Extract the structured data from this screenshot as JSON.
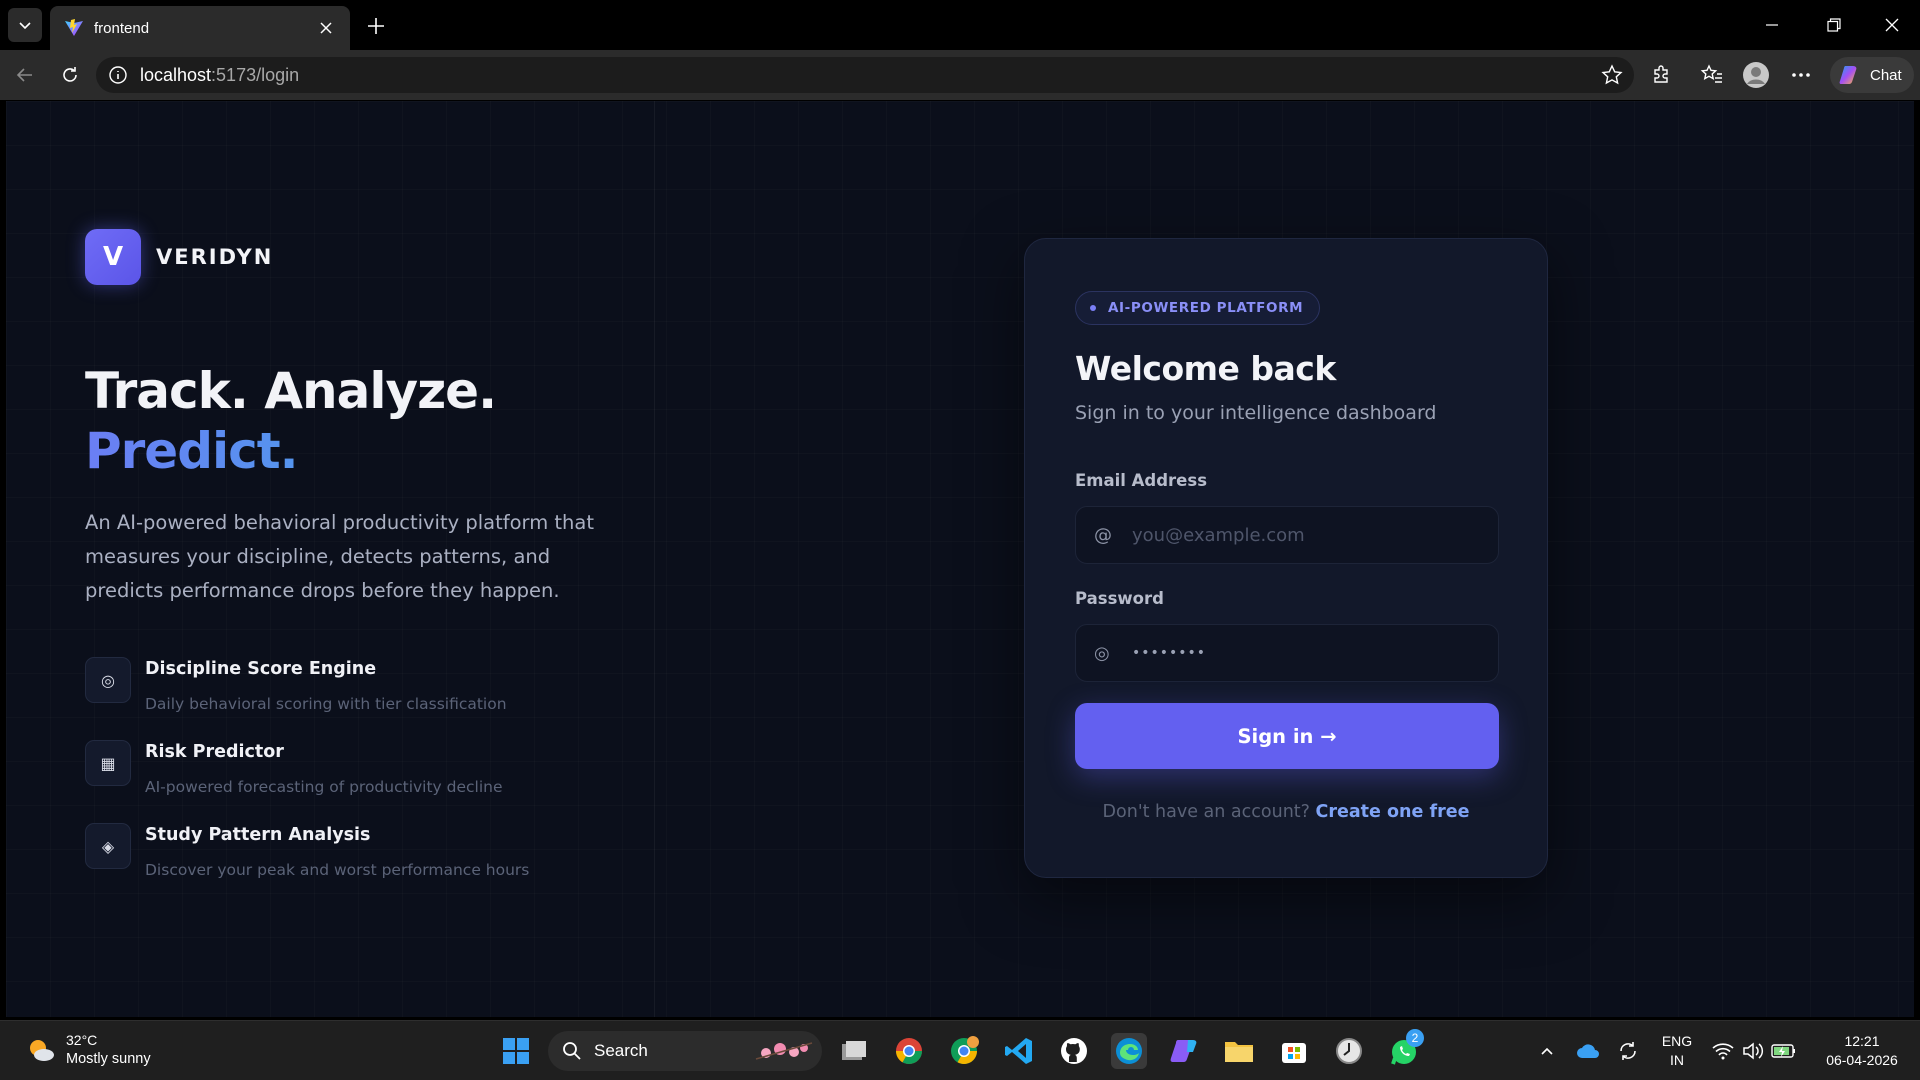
{
  "browser": {
    "tab_title": "frontend",
    "url_host": "localhost",
    "url_rest": ":5173/login",
    "chat_label": "Chat"
  },
  "page": {
    "brand": {
      "logo_letter": "V",
      "name": "VERIDYN"
    },
    "headline_line1": "Track. Analyze.",
    "headline_line2": "Predict.",
    "lead": "An AI-powered behavioral productivity platform that measures your discipline, detects patterns, and predicts performance drops before they happen.",
    "features": [
      {
        "icon": "◎",
        "title": "Discipline Score Engine",
        "desc": "Daily behavioral scoring with tier classification"
      },
      {
        "icon": "▦",
        "title": "Risk Predictor",
        "desc": "AI-powered forecasting of productivity decline"
      },
      {
        "icon": "◈",
        "title": "Study Pattern Analysis",
        "desc": "Discover your peak and worst performance hours"
      }
    ]
  },
  "login_card": {
    "badge": "AI-POWERED PLATFORM",
    "title": "Welcome back",
    "subtitle": "Sign in to your intelligence dashboard",
    "email_label": "Email Address",
    "email_icon": "@",
    "email_placeholder": "you@example.com",
    "password_label": "Password",
    "password_icon": "◎",
    "password_value": "••••••••",
    "signin_label": "Sign in →",
    "footer_prompt": "Don't have an account?",
    "footer_link": "Create one free"
  },
  "taskbar": {
    "weather_temp": "32°C",
    "weather_desc": "Mostly sunny",
    "search_label": "Search",
    "lang_line1": "ENG",
    "lang_line2": "IN",
    "time": "12:21",
    "date": "06-04-2026",
    "whatsapp_badge": "2"
  },
  "colors": {
    "accent": "#6360f0",
    "page_bg": "#0b0f1b",
    "card_bg": "#12182a",
    "link": "#7fa3f5"
  }
}
